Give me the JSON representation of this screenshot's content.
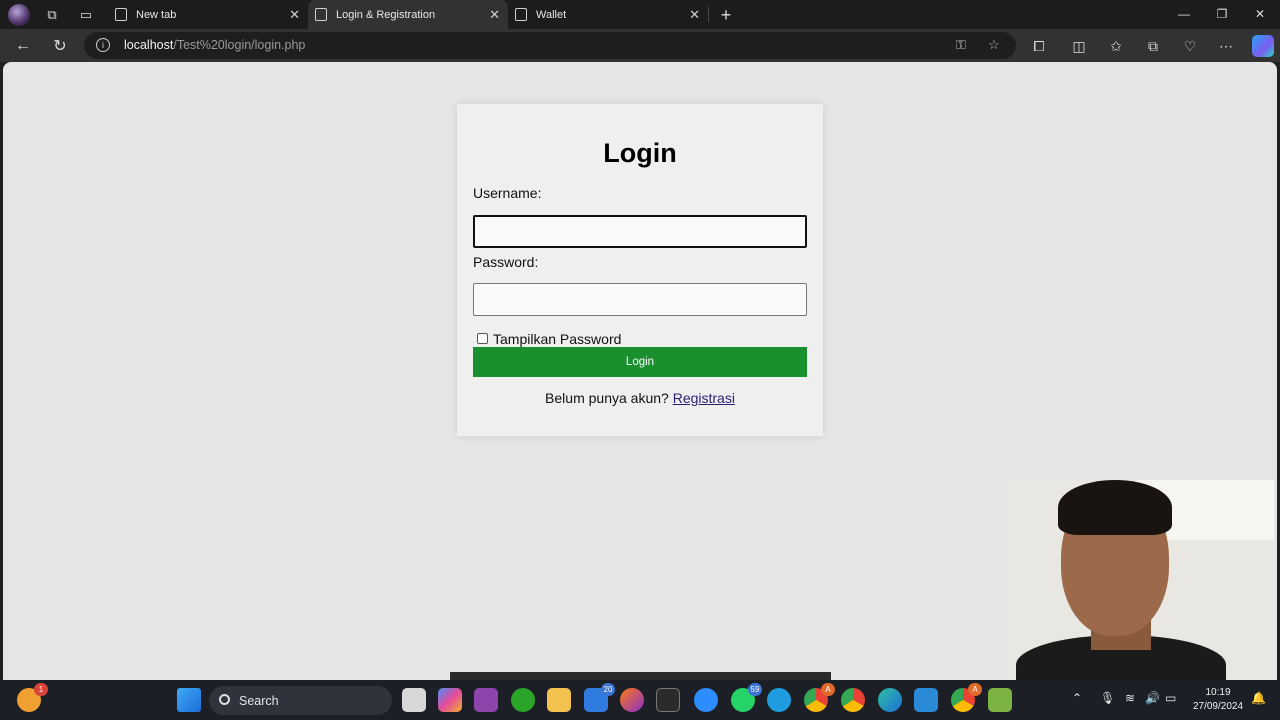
{
  "browser": {
    "tabs": [
      {
        "label": "New tab",
        "icon": "window-icon"
      },
      {
        "label": "Login & Registration",
        "icon": "page-icon",
        "active": true
      },
      {
        "label": "Wallet",
        "icon": "wallet-icon"
      }
    ],
    "url": {
      "host": "localhost",
      "path": "/Test%20login/login.php"
    }
  },
  "login": {
    "title": "Login",
    "username_label": "Username:",
    "username_value": "",
    "password_label": "Password:",
    "password_value": "",
    "show_password_label": "Tampilkan Password",
    "show_password_checked": false,
    "submit_label": "Login",
    "register_prompt": "Belum punya akun?",
    "register_link": "Registrasi",
    "submit_color": "#1a8f2e"
  },
  "taskbar": {
    "search_placeholder": "Search",
    "badges": {
      "store": "1",
      "app20": "20",
      "whatsapp": "59",
      "chrome1": "A",
      "chrome2": "A"
    },
    "time": "10:19",
    "date": "27/09/2024"
  }
}
